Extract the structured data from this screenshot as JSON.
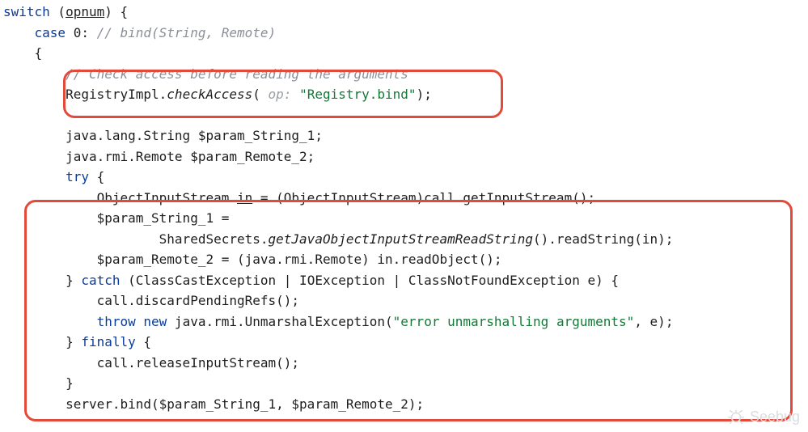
{
  "code": {
    "lines": [
      {
        "segs": [
          {
            "cls": "kw",
            "t": "switch"
          },
          {
            "t": " ("
          },
          {
            "cls": "ident-u",
            "t": "opnum"
          },
          {
            "t": ") {"
          }
        ]
      },
      {
        "indent": 4,
        "segs": [
          {
            "cls": "kw",
            "t": "case"
          },
          {
            "t": " 0: "
          },
          {
            "cls": "comment",
            "t": "// bind(String, Remote)"
          }
        ]
      },
      {
        "indent": 4,
        "segs": [
          {
            "t": "{"
          }
        ]
      },
      {
        "indent": 8,
        "segs": [
          {
            "cls": "comment",
            "t": "// Check access before reading the arguments"
          }
        ]
      },
      {
        "indent": 8,
        "segs": [
          {
            "t": "RegistryImpl."
          },
          {
            "cls": "call",
            "t": "checkAccess"
          },
          {
            "t": "( "
          },
          {
            "cls": "hint",
            "t": "op: "
          },
          {
            "cls": "string",
            "t": "\"Registry.bind\""
          },
          {
            "t": ");"
          }
        ]
      },
      {
        "indent": 0,
        "segs": [
          {
            "t": " "
          }
        ]
      },
      {
        "indent": 8,
        "segs": [
          {
            "t": "java.lang.String $param_String_1;"
          }
        ]
      },
      {
        "indent": 8,
        "segs": [
          {
            "t": "java.rmi.Remote $param_Remote_2;"
          }
        ]
      },
      {
        "indent": 8,
        "segs": [
          {
            "cls": "kw",
            "t": "try"
          },
          {
            "t": " {"
          }
        ]
      },
      {
        "indent": 12,
        "segs": [
          {
            "t": "ObjectInputStream "
          },
          {
            "cls": "ident-u",
            "t": "in"
          },
          {
            "t": " = (ObjectInputStream)call.getInputStream();"
          }
        ]
      },
      {
        "indent": 12,
        "segs": [
          {
            "t": "$param_String_1 ="
          }
        ]
      },
      {
        "indent": 20,
        "segs": [
          {
            "t": "SharedSecrets."
          },
          {
            "cls": "call",
            "t": "getJavaObjectInputStreamReadString"
          },
          {
            "t": "().readString(in);"
          }
        ]
      },
      {
        "indent": 12,
        "segs": [
          {
            "t": "$param_Remote_2 = (java.rmi.Remote) in.readObject();"
          }
        ]
      },
      {
        "indent": 8,
        "segs": [
          {
            "t": "} "
          },
          {
            "cls": "kw",
            "t": "catch"
          },
          {
            "t": " (ClassCastException | IOException | ClassNotFoundException e) {"
          }
        ]
      },
      {
        "indent": 12,
        "segs": [
          {
            "t": "call.discardPendingRefs();"
          }
        ]
      },
      {
        "indent": 12,
        "segs": [
          {
            "cls": "kw",
            "t": "throw new"
          },
          {
            "t": " java.rmi.UnmarshalException("
          },
          {
            "cls": "string",
            "t": "\"error unmarshalling arguments\""
          },
          {
            "t": ", e);"
          }
        ]
      },
      {
        "indent": 8,
        "segs": [
          {
            "t": "} "
          },
          {
            "cls": "kw",
            "t": "finally"
          },
          {
            "t": " {"
          }
        ]
      },
      {
        "indent": 12,
        "segs": [
          {
            "t": "call.releaseInputStream();"
          }
        ]
      },
      {
        "indent": 8,
        "segs": [
          {
            "t": "}"
          }
        ]
      },
      {
        "indent": 8,
        "segs": [
          {
            "t": "server.bind($param_String_1, $param_Remote_2);"
          }
        ]
      }
    ]
  },
  "watermark": {
    "text": "Seebug"
  }
}
